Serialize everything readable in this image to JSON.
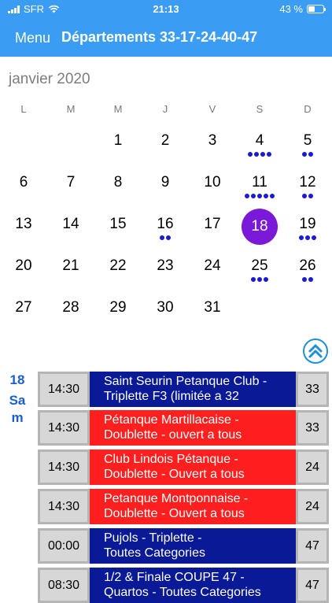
{
  "status": {
    "carrier": "SFR",
    "time": "21:13",
    "battery": "43 %"
  },
  "nav": {
    "menu": "Menu",
    "title": "Départements 33-17-24-40-47"
  },
  "calendar": {
    "month": "janvier 2020",
    "weekdays": [
      "L",
      "M",
      "M",
      "J",
      "V",
      "S",
      "D"
    ],
    "days": [
      {
        "n": "1"
      },
      {
        "n": "2"
      },
      {
        "n": "3"
      },
      {
        "n": "4",
        "dots": 4
      },
      {
        "n": "5",
        "dots": 2
      },
      {
        "n": "6"
      },
      {
        "n": "7"
      },
      {
        "n": "8"
      },
      {
        "n": "9"
      },
      {
        "n": "10"
      },
      {
        "n": "11",
        "dots": 5
      },
      {
        "n": "12",
        "dots": 2
      },
      {
        "n": "13"
      },
      {
        "n": "14"
      },
      {
        "n": "15"
      },
      {
        "n": "16",
        "dots": 2
      },
      {
        "n": "17"
      },
      {
        "n": "18",
        "selected": true
      },
      {
        "n": "19",
        "dots": 3
      },
      {
        "n": "20"
      },
      {
        "n": "21"
      },
      {
        "n": "22"
      },
      {
        "n": "23"
      },
      {
        "n": "24"
      },
      {
        "n": "25",
        "dots": 3
      },
      {
        "n": "26",
        "dots": 2
      },
      {
        "n": "27"
      },
      {
        "n": "28"
      },
      {
        "n": "29"
      },
      {
        "n": "30"
      },
      {
        "n": "31"
      }
    ]
  },
  "selected_day": {
    "num": "18",
    "label_line1": "Sa",
    "label_line2": "m"
  },
  "events": [
    {
      "time": "14:30",
      "line1": "Saint Seurin Petanque Club -",
      "line2": "Triplette F3 (limitée a 32",
      "count": "33",
      "color": "blue"
    },
    {
      "time": "14:30",
      "line1": "Pétanque Martillacaise -",
      "line2": "Doublette - ouvert a tous",
      "count": "33",
      "color": "red"
    },
    {
      "time": "14:30",
      "line1": "Club Lindois Pétanque -",
      "line2": "Doublette - Ouvert a tous",
      "count": "24",
      "color": "red"
    },
    {
      "time": "14:30",
      "line1": "Petanque Montponnaise -",
      "line2": "Doublette - Ouvert a tous",
      "count": "24",
      "color": "red"
    },
    {
      "time": "00:00",
      "line1": "Pujols - Triplette -",
      "line2": "Toutes Categories",
      "count": "47",
      "color": "blue"
    },
    {
      "time": "08:30",
      "line1": "1/2 & Finale COUPE 47 -",
      "line2": "Quartos - Toutes Categories",
      "count": "47",
      "color": "blue"
    }
  ],
  "colors": {
    "header": "#3a9cf2",
    "selected": "#7a1ad8",
    "dot": "#1a1ad6",
    "event_blue": "#0a1a97",
    "event_red": "#ff1f1f"
  }
}
